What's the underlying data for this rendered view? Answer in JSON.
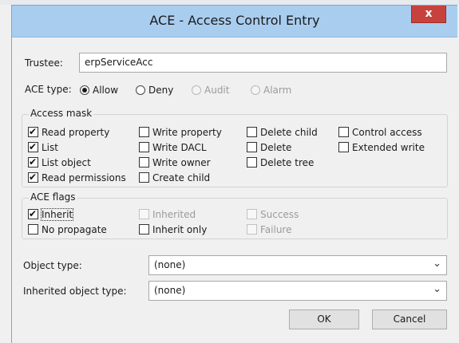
{
  "window": {
    "title": "ACE - Access Control Entry",
    "close_label": "x"
  },
  "trustee": {
    "label": "Trustee:",
    "value": "erpServiceAcc"
  },
  "ace_type": {
    "label": "ACE type:",
    "options": [
      {
        "label": "Allow",
        "checked": true,
        "enabled": true
      },
      {
        "label": "Deny",
        "checked": false,
        "enabled": true
      },
      {
        "label": "Audit",
        "checked": false,
        "enabled": false
      },
      {
        "label": "Alarm",
        "checked": false,
        "enabled": false
      }
    ]
  },
  "access_mask": {
    "title": "Access mask",
    "items": [
      {
        "label": "Read property",
        "checked": true
      },
      {
        "label": "List",
        "checked": true
      },
      {
        "label": "List object",
        "checked": true
      },
      {
        "label": "Read permissions",
        "checked": true
      },
      {
        "label": "Write property",
        "checked": false
      },
      {
        "label": "Write DACL",
        "checked": false
      },
      {
        "label": "Write owner",
        "checked": false
      },
      {
        "label": "Create child",
        "checked": false
      },
      {
        "label": "Delete child",
        "checked": false
      },
      {
        "label": "Delete",
        "checked": false
      },
      {
        "label": "Delete tree",
        "checked": false
      },
      {
        "label": "Control access",
        "checked": false
      },
      {
        "label": "Extended write",
        "checked": false
      }
    ]
  },
  "ace_flags": {
    "title": "ACE flags",
    "items": [
      {
        "label": "Inherit",
        "checked": true,
        "enabled": true
      },
      {
        "label": "No propagate",
        "checked": false,
        "enabled": true
      },
      {
        "label": "Inherited",
        "checked": false,
        "enabled": false
      },
      {
        "label": "Inherit only",
        "checked": false,
        "enabled": true
      },
      {
        "label": "Success",
        "checked": false,
        "enabled": false
      },
      {
        "label": "Failure",
        "checked": false,
        "enabled": false
      }
    ]
  },
  "object_type": {
    "label": "Object type:",
    "value": "(none)"
  },
  "inherited_object_type": {
    "label": "Inherited object type:",
    "value": "(none)"
  },
  "buttons": {
    "ok": "OK",
    "cancel": "Cancel"
  },
  "icons": {
    "dropdown": "chevron-down-icon"
  }
}
